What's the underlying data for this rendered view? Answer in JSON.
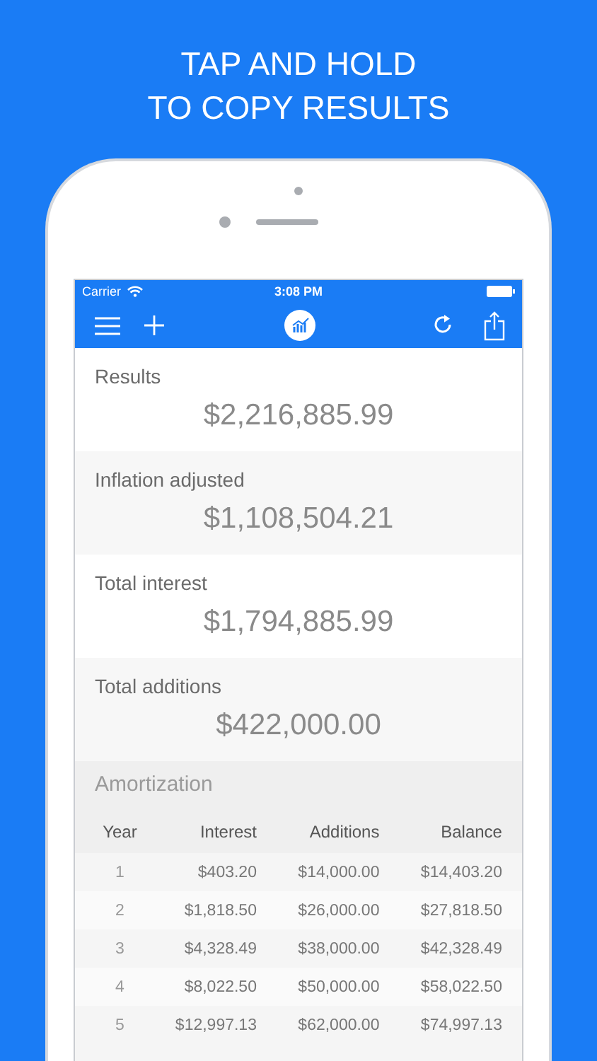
{
  "headline": [
    "TAP AND HOLD",
    "TO COPY RESULTS"
  ],
  "status_bar": {
    "carrier": "Carrier",
    "time": "3:08 PM"
  },
  "results": [
    {
      "label": "Results",
      "value": "$2,216,885.99"
    },
    {
      "label": "Inflation adjusted",
      "value": "$1,108,504.21"
    },
    {
      "label": "Total interest",
      "value": "$1,794,885.99"
    },
    {
      "label": "Total additions",
      "value": "$422,000.00"
    }
  ],
  "amortization": {
    "title": "Amortization",
    "columns": [
      "Year",
      "Interest",
      "Additions",
      "Balance"
    ],
    "rows": [
      [
        "1",
        "$403.20",
        "$14,000.00",
        "$14,403.20"
      ],
      [
        "2",
        "$1,818.50",
        "$26,000.00",
        "$27,818.50"
      ],
      [
        "3",
        "$4,328.49",
        "$38,000.00",
        "$42,328.49"
      ],
      [
        "4",
        "$8,022.50",
        "$50,000.00",
        "$58,022.50"
      ],
      [
        "5",
        "$12,997.13",
        "$62,000.00",
        "$74,997.13"
      ]
    ]
  }
}
